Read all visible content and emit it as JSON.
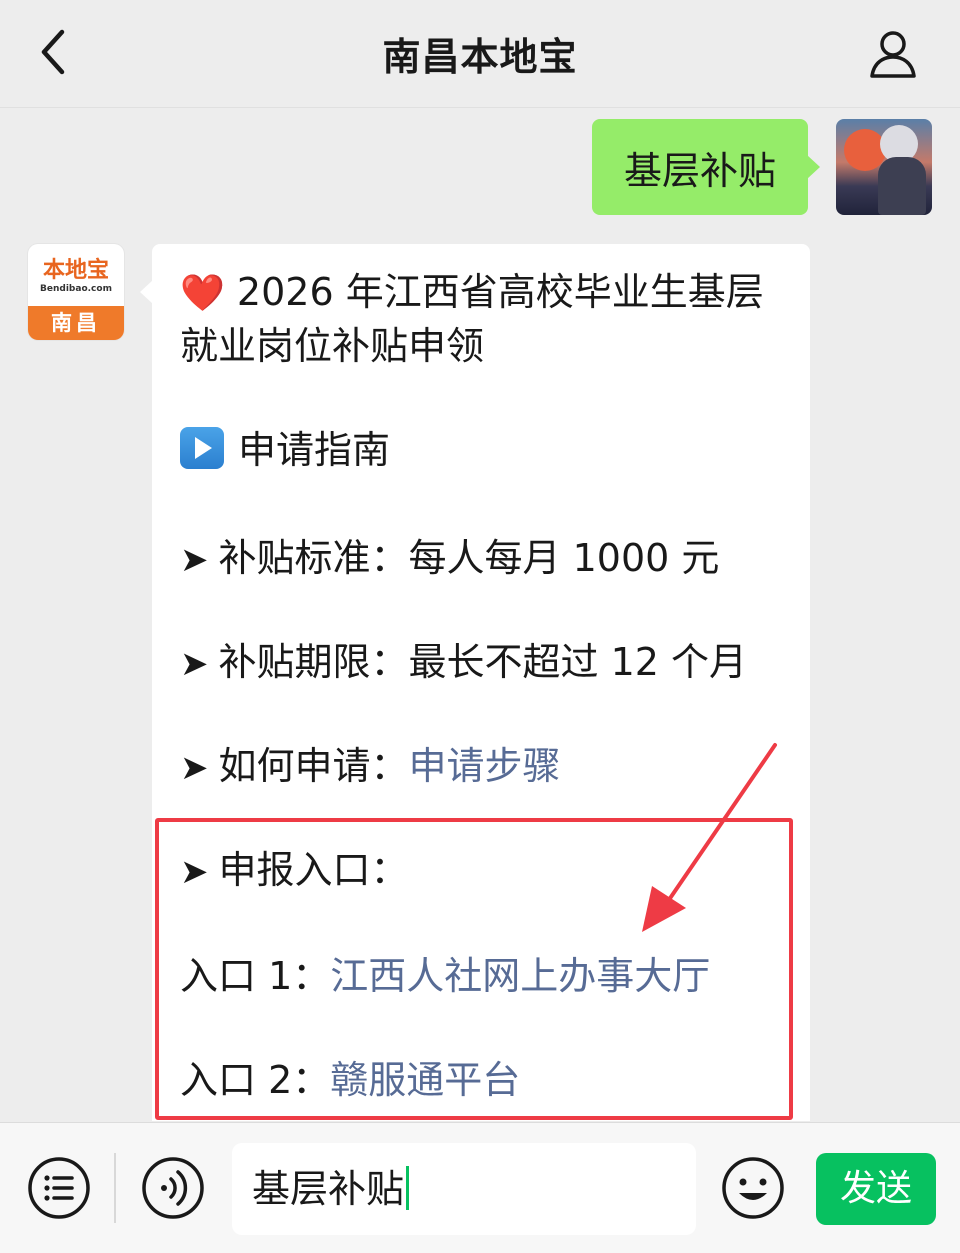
{
  "header": {
    "title": "南昌本地宝"
  },
  "user_message": {
    "text": "基层补贴"
  },
  "bot_avatar": {
    "logo_text": "本地宝",
    "logo_sub": "Bendibao.com",
    "city": "南昌"
  },
  "bot_message": {
    "heart_icon": "❤️",
    "title": "2026 年江西省高校毕业生基层就业岗位补贴申领",
    "guide_label": "申请指南",
    "arrow": "➤",
    "standard_label": "补贴标准：",
    "standard_value": "每人每月 1000 元",
    "period_label": "补贴期限：",
    "period_value": "最长不超过 12 个月",
    "how_label": "如何申请：",
    "how_link": "申请步骤",
    "entry_label": "申报入口：",
    "entry1_label": "入口 1：",
    "entry1_link": "江西人社网上办事大厅",
    "entry2_label": "入口 2：",
    "entry2_link": "赣服通平台"
  },
  "input_bar": {
    "value": "基层补贴",
    "send_label": "发送"
  },
  "colors": {
    "user_bubble": "#95ec69",
    "link": "#576b95",
    "send_button": "#07c160",
    "highlight": "#ee3b45"
  },
  "icons": {
    "back": "chevron-left-icon",
    "profile": "person-icon",
    "menu": "list-menu-icon",
    "voice": "voice-icon",
    "emoji": "smile-icon"
  }
}
